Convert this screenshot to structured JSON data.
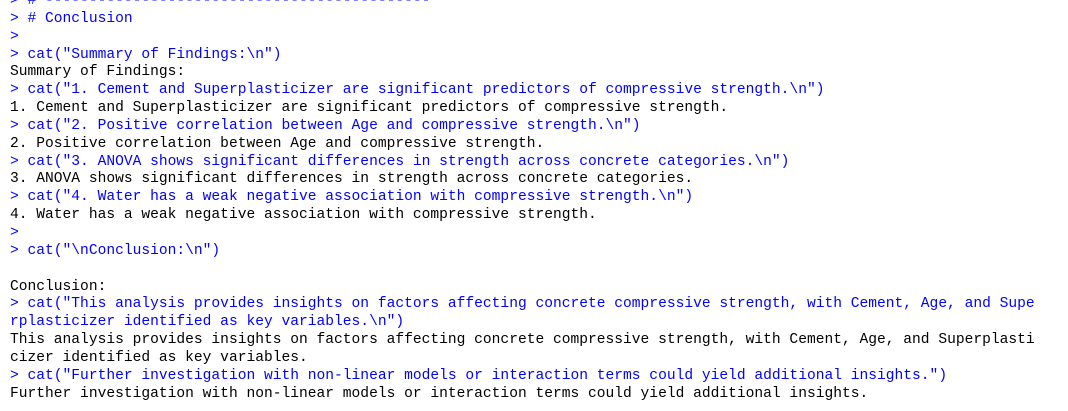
{
  "console": {
    "lines": [
      {
        "type": "in",
        "text": "> # --------------------------------------------"
      },
      {
        "type": "in",
        "text": "> # Conclusion"
      },
      {
        "type": "in",
        "text": ">"
      },
      {
        "type": "in",
        "text": "> cat(\"Summary of Findings:\\n\")"
      },
      {
        "type": "out",
        "text": "Summary of Findings:"
      },
      {
        "type": "in",
        "text": "> cat(\"1. Cement and Superplasticizer are significant predictors of compressive strength.\\n\")"
      },
      {
        "type": "out",
        "text": "1. Cement and Superplasticizer are significant predictors of compressive strength."
      },
      {
        "type": "in",
        "text": "> cat(\"2. Positive correlation between Age and compressive strength.\\n\")"
      },
      {
        "type": "out",
        "text": "2. Positive correlation between Age and compressive strength."
      },
      {
        "type": "in",
        "text": "> cat(\"3. ANOVA shows significant differences in strength across concrete categories.\\n\")"
      },
      {
        "type": "out",
        "text": "3. ANOVA shows significant differences in strength across concrete categories."
      },
      {
        "type": "in",
        "text": "> cat(\"4. Water has a weak negative association with compressive strength.\\n\")"
      },
      {
        "type": "out",
        "text": "4. Water has a weak negative association with compressive strength."
      },
      {
        "type": "in",
        "text": ">"
      },
      {
        "type": "in",
        "text": "> cat(\"\\nConclusion:\\n\")"
      },
      {
        "type": "blank",
        "text": ""
      },
      {
        "type": "out",
        "text": "Conclusion:"
      },
      {
        "type": "in",
        "text": "> cat(\"This analysis provides insights on factors affecting concrete compressive strength, with Cement, Age, and Supe"
      },
      {
        "type": "in",
        "text": "rplasticizer identified as key variables.\\n\")"
      },
      {
        "type": "out",
        "text": "This analysis provides insights on factors affecting concrete compressive strength, with Cement, Age, and Superplasti"
      },
      {
        "type": "out",
        "text": "cizer identified as key variables."
      },
      {
        "type": "in",
        "text": "> cat(\"Further investigation with non-linear models or interaction terms could yield additional insights.\")"
      },
      {
        "type": "out",
        "text": "Further investigation with non-linear models or interaction terms could yield additional insights."
      }
    ]
  }
}
